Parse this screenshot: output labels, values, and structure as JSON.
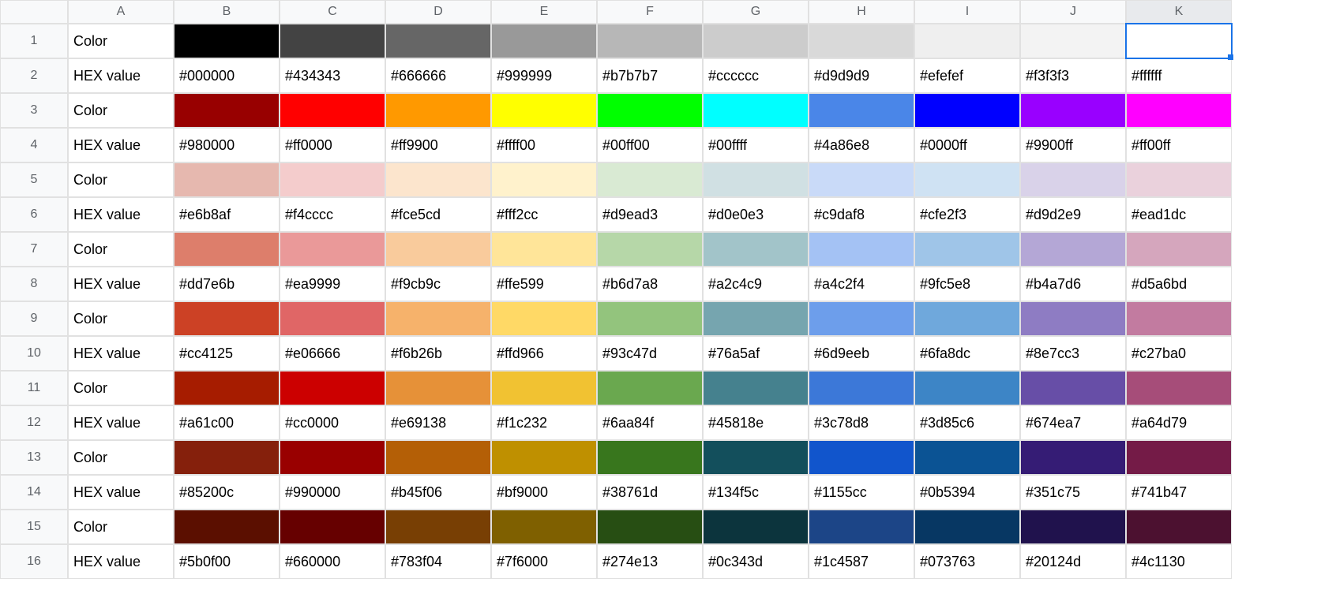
{
  "columns": [
    "A",
    "B",
    "C",
    "D",
    "E",
    "F",
    "G",
    "H",
    "I",
    "J",
    "K"
  ],
  "row_numbers": [
    "1",
    "2",
    "3",
    "4",
    "5",
    "6",
    "7",
    "8",
    "9",
    "10",
    "11",
    "12",
    "13",
    "14",
    "15",
    "16"
  ],
  "labels": {
    "color": "Color",
    "hex": "HEX value"
  },
  "groups": [
    {
      "colors": [
        "#000000",
        "#434343",
        "#666666",
        "#999999",
        "#b7b7b7",
        "#cccccc",
        "#d9d9d9",
        "#efefef",
        "#f3f3f3",
        "#ffffff"
      ],
      "hex": [
        "#000000",
        "#434343",
        "#666666",
        "#999999",
        "#b7b7b7",
        "#cccccc",
        "#d9d9d9",
        "#efefef",
        "#f3f3f3",
        "#ffffff"
      ]
    },
    {
      "colors": [
        "#980000",
        "#ff0000",
        "#ff9900",
        "#ffff00",
        "#00ff00",
        "#00ffff",
        "#4a86e8",
        "#0000ff",
        "#9900ff",
        "#ff00ff"
      ],
      "hex": [
        "#980000",
        "#ff0000",
        "#ff9900",
        "#ffff00",
        "#00ff00",
        "#00ffff",
        "#4a86e8",
        "#0000ff",
        "#9900ff",
        "#ff00ff"
      ]
    },
    {
      "colors": [
        "#e6b8af",
        "#f4cccc",
        "#fce5cd",
        "#fff2cc",
        "#d9ead3",
        "#d0e0e3",
        "#c9daf8",
        "#cfe2f3",
        "#d9d2e9",
        "#ead1dc"
      ],
      "hex": [
        "#e6b8af",
        "#f4cccc",
        "#fce5cd",
        "#fff2cc",
        "#d9ead3",
        "#d0e0e3",
        "#c9daf8",
        "#cfe2f3",
        "#d9d2e9",
        "#ead1dc"
      ]
    },
    {
      "colors": [
        "#dd7e6b",
        "#ea9999",
        "#f9cb9c",
        "#ffe599",
        "#b6d7a8",
        "#a2c4c9",
        "#a4c2f4",
        "#9fc5e8",
        "#b4a7d6",
        "#d5a6bd"
      ],
      "hex": [
        "#dd7e6b",
        "#ea9999",
        "#f9cb9c",
        "#ffe599",
        "#b6d7a8",
        "#a2c4c9",
        "#a4c2f4",
        "#9fc5e8",
        "#b4a7d6",
        "#d5a6bd"
      ]
    },
    {
      "colors": [
        "#cc4125",
        "#e06666",
        "#f6b26b",
        "#ffd966",
        "#93c47d",
        "#76a5af",
        "#6d9eeb",
        "#6fa8dc",
        "#8e7cc3",
        "#c27ba0"
      ],
      "hex": [
        "#cc4125",
        "#e06666",
        "#f6b26b",
        "#ffd966",
        "#93c47d",
        "#76a5af",
        "#6d9eeb",
        "#6fa8dc",
        "#8e7cc3",
        "#c27ba0"
      ]
    },
    {
      "colors": [
        "#a61c00",
        "#cc0000",
        "#e69138",
        "#f1c232",
        "#6aa84f",
        "#45818e",
        "#3c78d8",
        "#3d85c6",
        "#674ea7",
        "#a64d79"
      ],
      "hex": [
        "#a61c00",
        "#cc0000",
        "#e69138",
        "#f1c232",
        "#6aa84f",
        "#45818e",
        "#3c78d8",
        "#3d85c6",
        "#674ea7",
        "#a64d79"
      ]
    },
    {
      "colors": [
        "#85200c",
        "#990000",
        "#b45f06",
        "#bf9000",
        "#38761d",
        "#134f5c",
        "#1155cc",
        "#0b5394",
        "#351c75",
        "#741b47"
      ],
      "hex": [
        "#85200c",
        "#990000",
        "#b45f06",
        "#bf9000",
        "#38761d",
        "#134f5c",
        "#1155cc",
        "#0b5394",
        "#351c75",
        "#741b47"
      ]
    },
    {
      "colors": [
        "#5b0f00",
        "#660000",
        "#783f04",
        "#7f6000",
        "#274e13",
        "#0c343d",
        "#1c4587",
        "#073763",
        "#20124d",
        "#4c1130"
      ],
      "hex": [
        "#5b0f00",
        "#660000",
        "#783f04",
        "#7f6000",
        "#274e13",
        "#0c343d",
        "#1c4587",
        "#073763",
        "#20124d",
        "#4c1130"
      ]
    }
  ],
  "selected_cell": "K1"
}
